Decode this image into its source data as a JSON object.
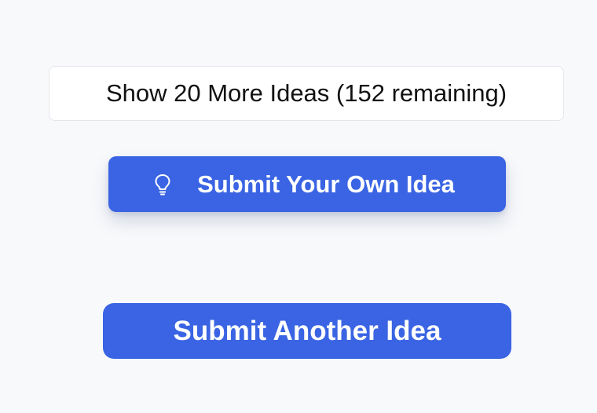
{
  "buttons": {
    "show_more_label": "Show 20 More Ideas (152 remaining)",
    "submit_own_label": "Submit Your Own Idea",
    "submit_own_icon": "lightbulb-icon",
    "submit_another_label": "Submit Another Idea"
  },
  "colors": {
    "background": "#f8f9fb",
    "primary": "#3a64e3",
    "secondary_button_bg": "#ffffff",
    "secondary_button_border": "#e3e6eb"
  }
}
